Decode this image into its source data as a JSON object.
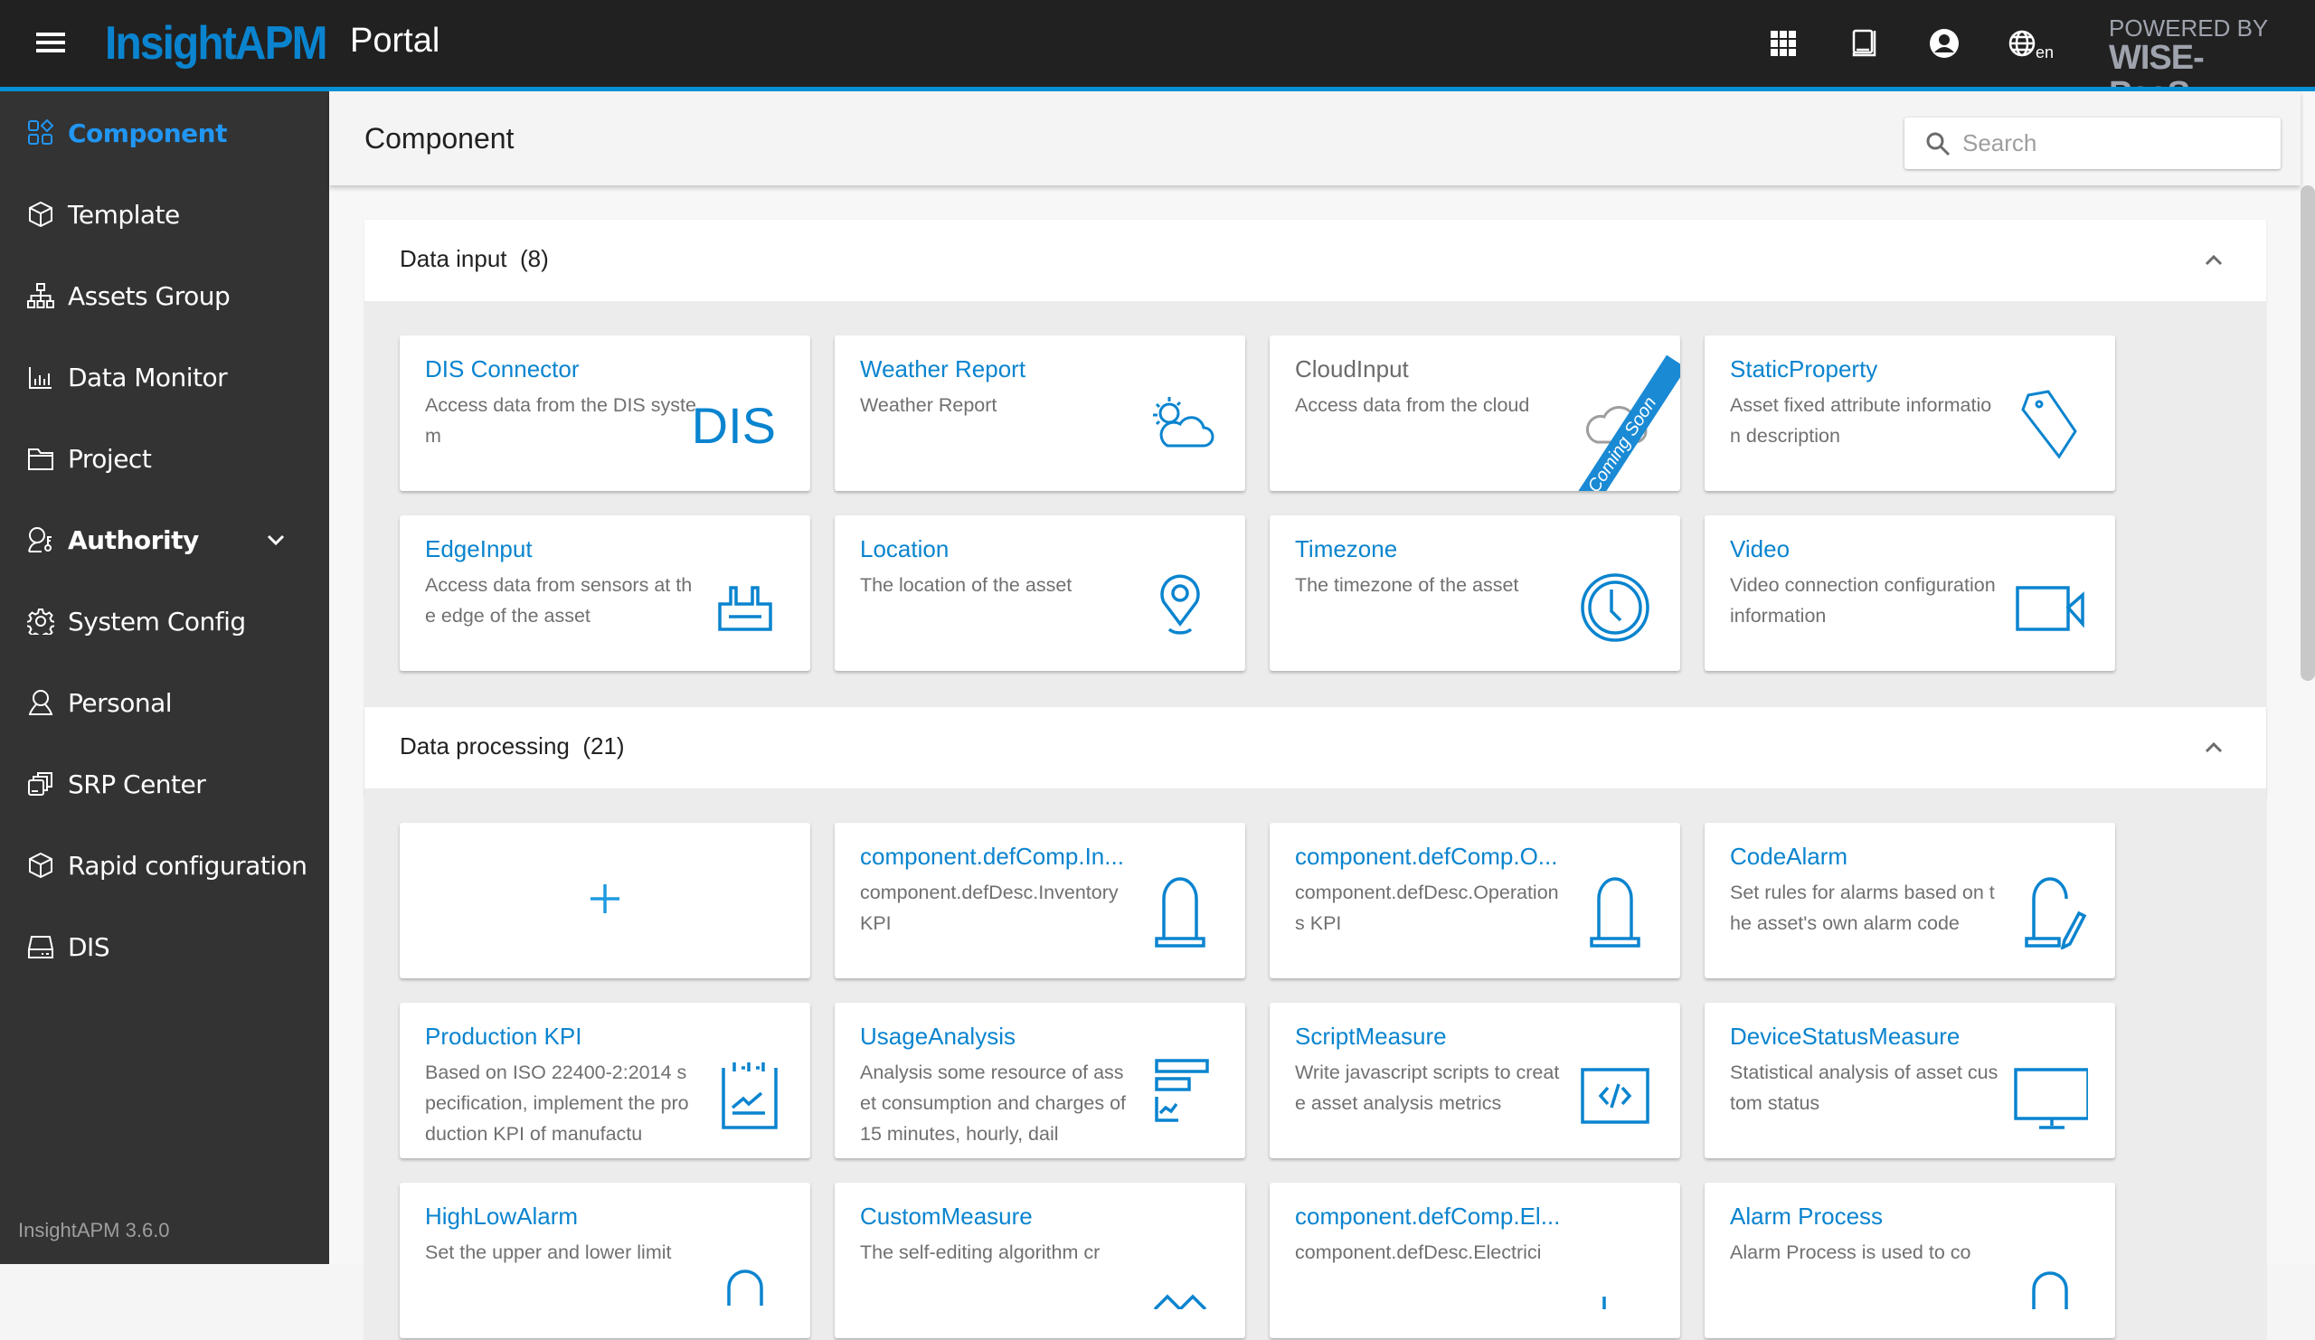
{
  "header": {
    "brand": "InsightAPM",
    "portal": "Portal",
    "language": "en",
    "powered_by_line1": "POWERED BY",
    "powered_by_line2": "WISE-PaaS",
    "icons": [
      "apps-grid-icon",
      "manual-book-icon",
      "account-icon",
      "language-globe-icon"
    ]
  },
  "sidebar": {
    "items": [
      {
        "label": "Component",
        "icon": "component-icon",
        "active": true
      },
      {
        "label": "Template",
        "icon": "cube-icon"
      },
      {
        "label": "Assets Group",
        "icon": "hierarchy-icon"
      },
      {
        "label": "Data Monitor",
        "icon": "bar-chart-icon"
      },
      {
        "label": "Project",
        "icon": "folder-icon"
      },
      {
        "label": "Authority",
        "icon": "user-key-icon",
        "expandable": true
      },
      {
        "label": "System Config",
        "icon": "gear-icon"
      },
      {
        "label": "Personal",
        "icon": "person-icon"
      },
      {
        "label": "SRP Center",
        "icon": "stacked-windows-icon"
      },
      {
        "label": "Rapid configuration",
        "icon": "cube-icon"
      },
      {
        "label": "DIS",
        "icon": "drive-icon"
      }
    ],
    "version": "InsightAPM 3.6.0"
  },
  "page": {
    "title": "Component",
    "search_placeholder": "Search"
  },
  "sections": [
    {
      "title": "Data input",
      "count": "(8)",
      "cards": [
        {
          "title": "DIS Connector",
          "desc": "Access data from the DIS system",
          "icon": "dis-text-icon",
          "icon_text": "DIS"
        },
        {
          "title": "Weather Report",
          "desc": "Weather Report",
          "icon": "weather-icon"
        },
        {
          "title": "CloudInput",
          "desc": "Access data from the cloud",
          "icon": "cloud-icon",
          "disabled": true,
          "ribbon": "Coming Soon"
        },
        {
          "title": "StaticProperty",
          "desc": "Asset fixed attribute information description",
          "icon": "tag-icon"
        },
        {
          "title": "EdgeInput",
          "desc": "Access data from sensors at the edge of the asset",
          "icon": "edge-device-icon"
        },
        {
          "title": "Location",
          "desc": "The location of the asset",
          "icon": "location-pin-icon"
        },
        {
          "title": "Timezone",
          "desc": "The timezone of the asset",
          "icon": "clock-icon"
        },
        {
          "title": "Video",
          "desc": "Video connection configuration information",
          "icon": "video-camera-icon"
        }
      ]
    },
    {
      "title": "Data processing",
      "count": "(21)",
      "cards": [
        {
          "title": "",
          "desc": "",
          "icon": "add-icon",
          "add": true
        },
        {
          "title": "component.defComp.In...",
          "desc": "component.defDesc.Inventory KPI",
          "icon": "beacon-icon"
        },
        {
          "title": "component.defComp.O...",
          "desc": "component.defDesc.Operations KPI",
          "icon": "beacon-icon"
        },
        {
          "title": "CodeAlarm",
          "desc": "Set rules for alarms based on the asset's own alarm code",
          "icon": "beacon-edit-icon"
        },
        {
          "title": "Production KPI",
          "desc": "Based on ISO 22400-2:2014 specification, implement the production KPI of manufactu",
          "icon": "clipboard-chart-icon"
        },
        {
          "title": "UsageAnalysis",
          "desc": "Analysis some resource of asset consumption and charges of 15 minutes, hourly, dail",
          "icon": "usage-bars-icon"
        },
        {
          "title": "ScriptMeasure",
          "desc": "Write javascript scripts to create asset analysis metrics",
          "icon": "code-icon"
        },
        {
          "title": "DeviceStatusMeasure",
          "desc": "Statistical analysis of asset custom status",
          "icon": "monitor-icon"
        },
        {
          "title": "HighLowAlarm",
          "desc": "Set the upper and lower limit",
          "icon": "alarm-icon"
        },
        {
          "title": "CustomMeasure",
          "desc": "The self-editing algorithm cr",
          "icon": "custom-measure-icon"
        },
        {
          "title": "component.defComp.El...",
          "desc": "component.defDesc.Electrici",
          "icon": "electricity-icon"
        },
        {
          "title": "Alarm Process",
          "desc": "Alarm Process is used to co",
          "icon": "alarm-process-icon"
        }
      ]
    }
  ],
  "colors": {
    "accent": "#0a84cf",
    "header_bg": "#212121",
    "sidebar_bg": "#333333",
    "active_item": "#2196f3"
  }
}
